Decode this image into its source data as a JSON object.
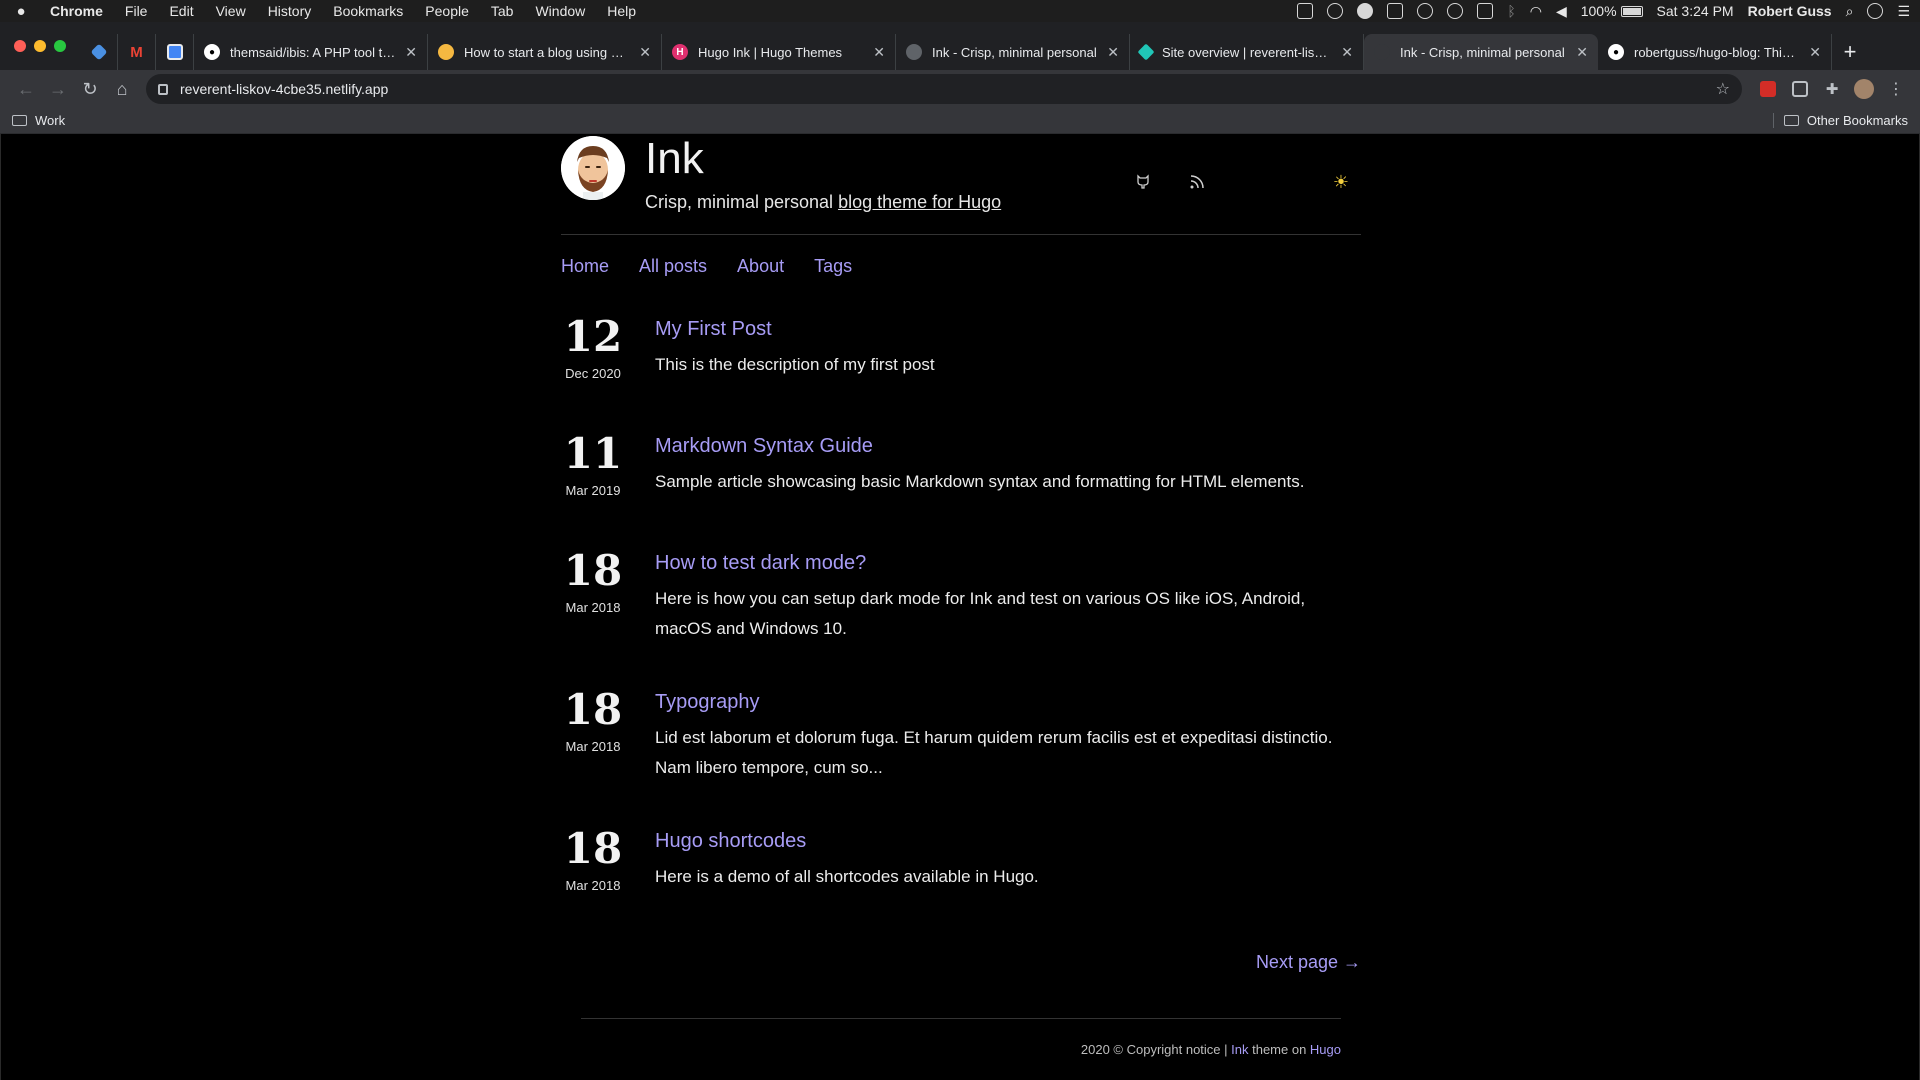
{
  "menubar": {
    "app": "Chrome",
    "items": [
      "File",
      "Edit",
      "View",
      "History",
      "Bookmarks",
      "People",
      "Tab",
      "Window",
      "Help"
    ],
    "battery": "100%",
    "clock": "Sat 3:24 PM",
    "user": "Robert Guss"
  },
  "tabs": [
    {
      "title": "themsaid/ibis: A PHP tool that",
      "favicon_color": "#ffffff",
      "favicon_icon": "github-icon"
    },
    {
      "title": "How to start a blog using Hug",
      "favicon_color": "#f5b841",
      "favicon_icon": "blog-icon"
    },
    {
      "title": "Hugo Ink | Hugo Themes",
      "favicon_color": "#e0306f",
      "favicon_icon": "hugo-icon"
    },
    {
      "title": "Ink - Crisp, minimal personal",
      "favicon_color": "#5f6368",
      "favicon_icon": "globe-icon"
    },
    {
      "title": "Site overview | reverent-liskov",
      "favicon_color": "#20c6b7",
      "favicon_icon": "netlify-icon"
    },
    {
      "title": "Ink - Crisp, minimal personal",
      "favicon_color": "#35363a",
      "favicon_icon": "globe-icon",
      "active": true
    },
    {
      "title": "robertguss/hugo-blog: This is",
      "favicon_color": "#ffffff",
      "favicon_icon": "github-icon"
    }
  ],
  "toolbar": {
    "url": "reverent-liskov-4cbe35.netlify.app"
  },
  "bookmarks": {
    "folder": "Work",
    "other": "Other Bookmarks"
  },
  "site": {
    "title": "Ink",
    "tagline_prefix": "Crisp, minimal personal ",
    "tagline_link": "blog theme for Hugo"
  },
  "nav": [
    "Home",
    "All posts",
    "About",
    "Tags"
  ],
  "posts": [
    {
      "day": "12",
      "month": "Dec 2020",
      "title": "My First Post",
      "desc": "This is the description of my first post"
    },
    {
      "day": "11",
      "month": "Mar 2019",
      "title": "Markdown Syntax Guide",
      "desc": "Sample article showcasing basic Markdown syntax and formatting for HTML elements."
    },
    {
      "day": "18",
      "month": "Mar 2018",
      "title": "How to test dark mode?",
      "desc": "Here is how you can setup dark mode for Ink and test on various OS like iOS, Android, macOS and Windows 10."
    },
    {
      "day": "18",
      "month": "Mar 2018",
      "title": "Typography",
      "desc": "Lid est laborum et dolorum fuga. Et harum quidem rerum facilis est et expeditasi distinctio. Nam libero tempore, cum so..."
    },
    {
      "day": "18",
      "month": "Mar 2018",
      "title": "Hugo shortcodes",
      "desc": "Here is a demo of all shortcodes available in Hugo."
    }
  ],
  "pagination": {
    "next": "Next page →"
  },
  "footer": {
    "copyright": "2020 © Copyright notice | ",
    "ink": "Ink",
    "theme_on": " theme on ",
    "hugo": "Hugo"
  },
  "colors": {
    "accent": "#a79cf5",
    "background": "#000000",
    "theme_toggle": "#f4d03f"
  }
}
